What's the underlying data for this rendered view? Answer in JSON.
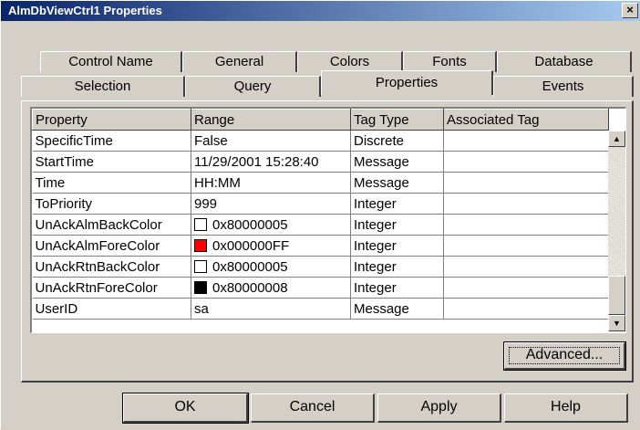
{
  "window": {
    "title": "AlmDbViewCtrl1 Properties",
    "close_glyph": "×"
  },
  "tabs_row1": [
    {
      "label": "Control Name"
    },
    {
      "label": "General"
    },
    {
      "label": "Colors"
    },
    {
      "label": "Fonts"
    },
    {
      "label": "Database"
    }
  ],
  "tabs_row2": [
    {
      "label": "Selection"
    },
    {
      "label": "Query"
    },
    {
      "label": "Properties",
      "active": true
    },
    {
      "label": "Events"
    }
  ],
  "grid": {
    "columns": [
      "Property",
      "Range",
      "Tag Type",
      "Associated Tag"
    ],
    "rows": [
      {
        "property": "SpecificTime",
        "range": "False",
        "tag_type": "Discrete",
        "associated": ""
      },
      {
        "property": "StartTime",
        "range": "11/29/2001 15:28:40",
        "tag_type": "Message",
        "associated": ""
      },
      {
        "property": "Time",
        "range": "HH:MM",
        "tag_type": "Message",
        "associated": ""
      },
      {
        "property": "ToPriority",
        "range": "999",
        "tag_type": "Integer",
        "associated": ""
      },
      {
        "property": "UnAckAlmBackColor",
        "range": "0x80000005",
        "tag_type": "Integer",
        "associated": "",
        "swatch": "#ffffff"
      },
      {
        "property": "UnAckAlmForeColor",
        "range": "0x000000FF",
        "tag_type": "Integer",
        "associated": "",
        "swatch": "#ff0000"
      },
      {
        "property": "UnAckRtnBackColor",
        "range": "0x80000005",
        "tag_type": "Integer",
        "associated": "",
        "swatch": "#ffffff"
      },
      {
        "property": "UnAckRtnForeColor",
        "range": "0x80000008",
        "tag_type": "Integer",
        "associated": "",
        "swatch": "#000000"
      },
      {
        "property": "UserID",
        "range": "sa",
        "tag_type": "Message",
        "associated": ""
      }
    ],
    "scroll": {
      "up_glyph": "▲",
      "down_glyph": "▼"
    }
  },
  "buttons": {
    "advanced": "Advanced...",
    "ok": "OK",
    "cancel": "Cancel",
    "apply": "Apply",
    "help": "Help"
  },
  "colors": {
    "title_start": "#0a246a",
    "title_end": "#a6caf0",
    "face": "#d4d0c8"
  }
}
